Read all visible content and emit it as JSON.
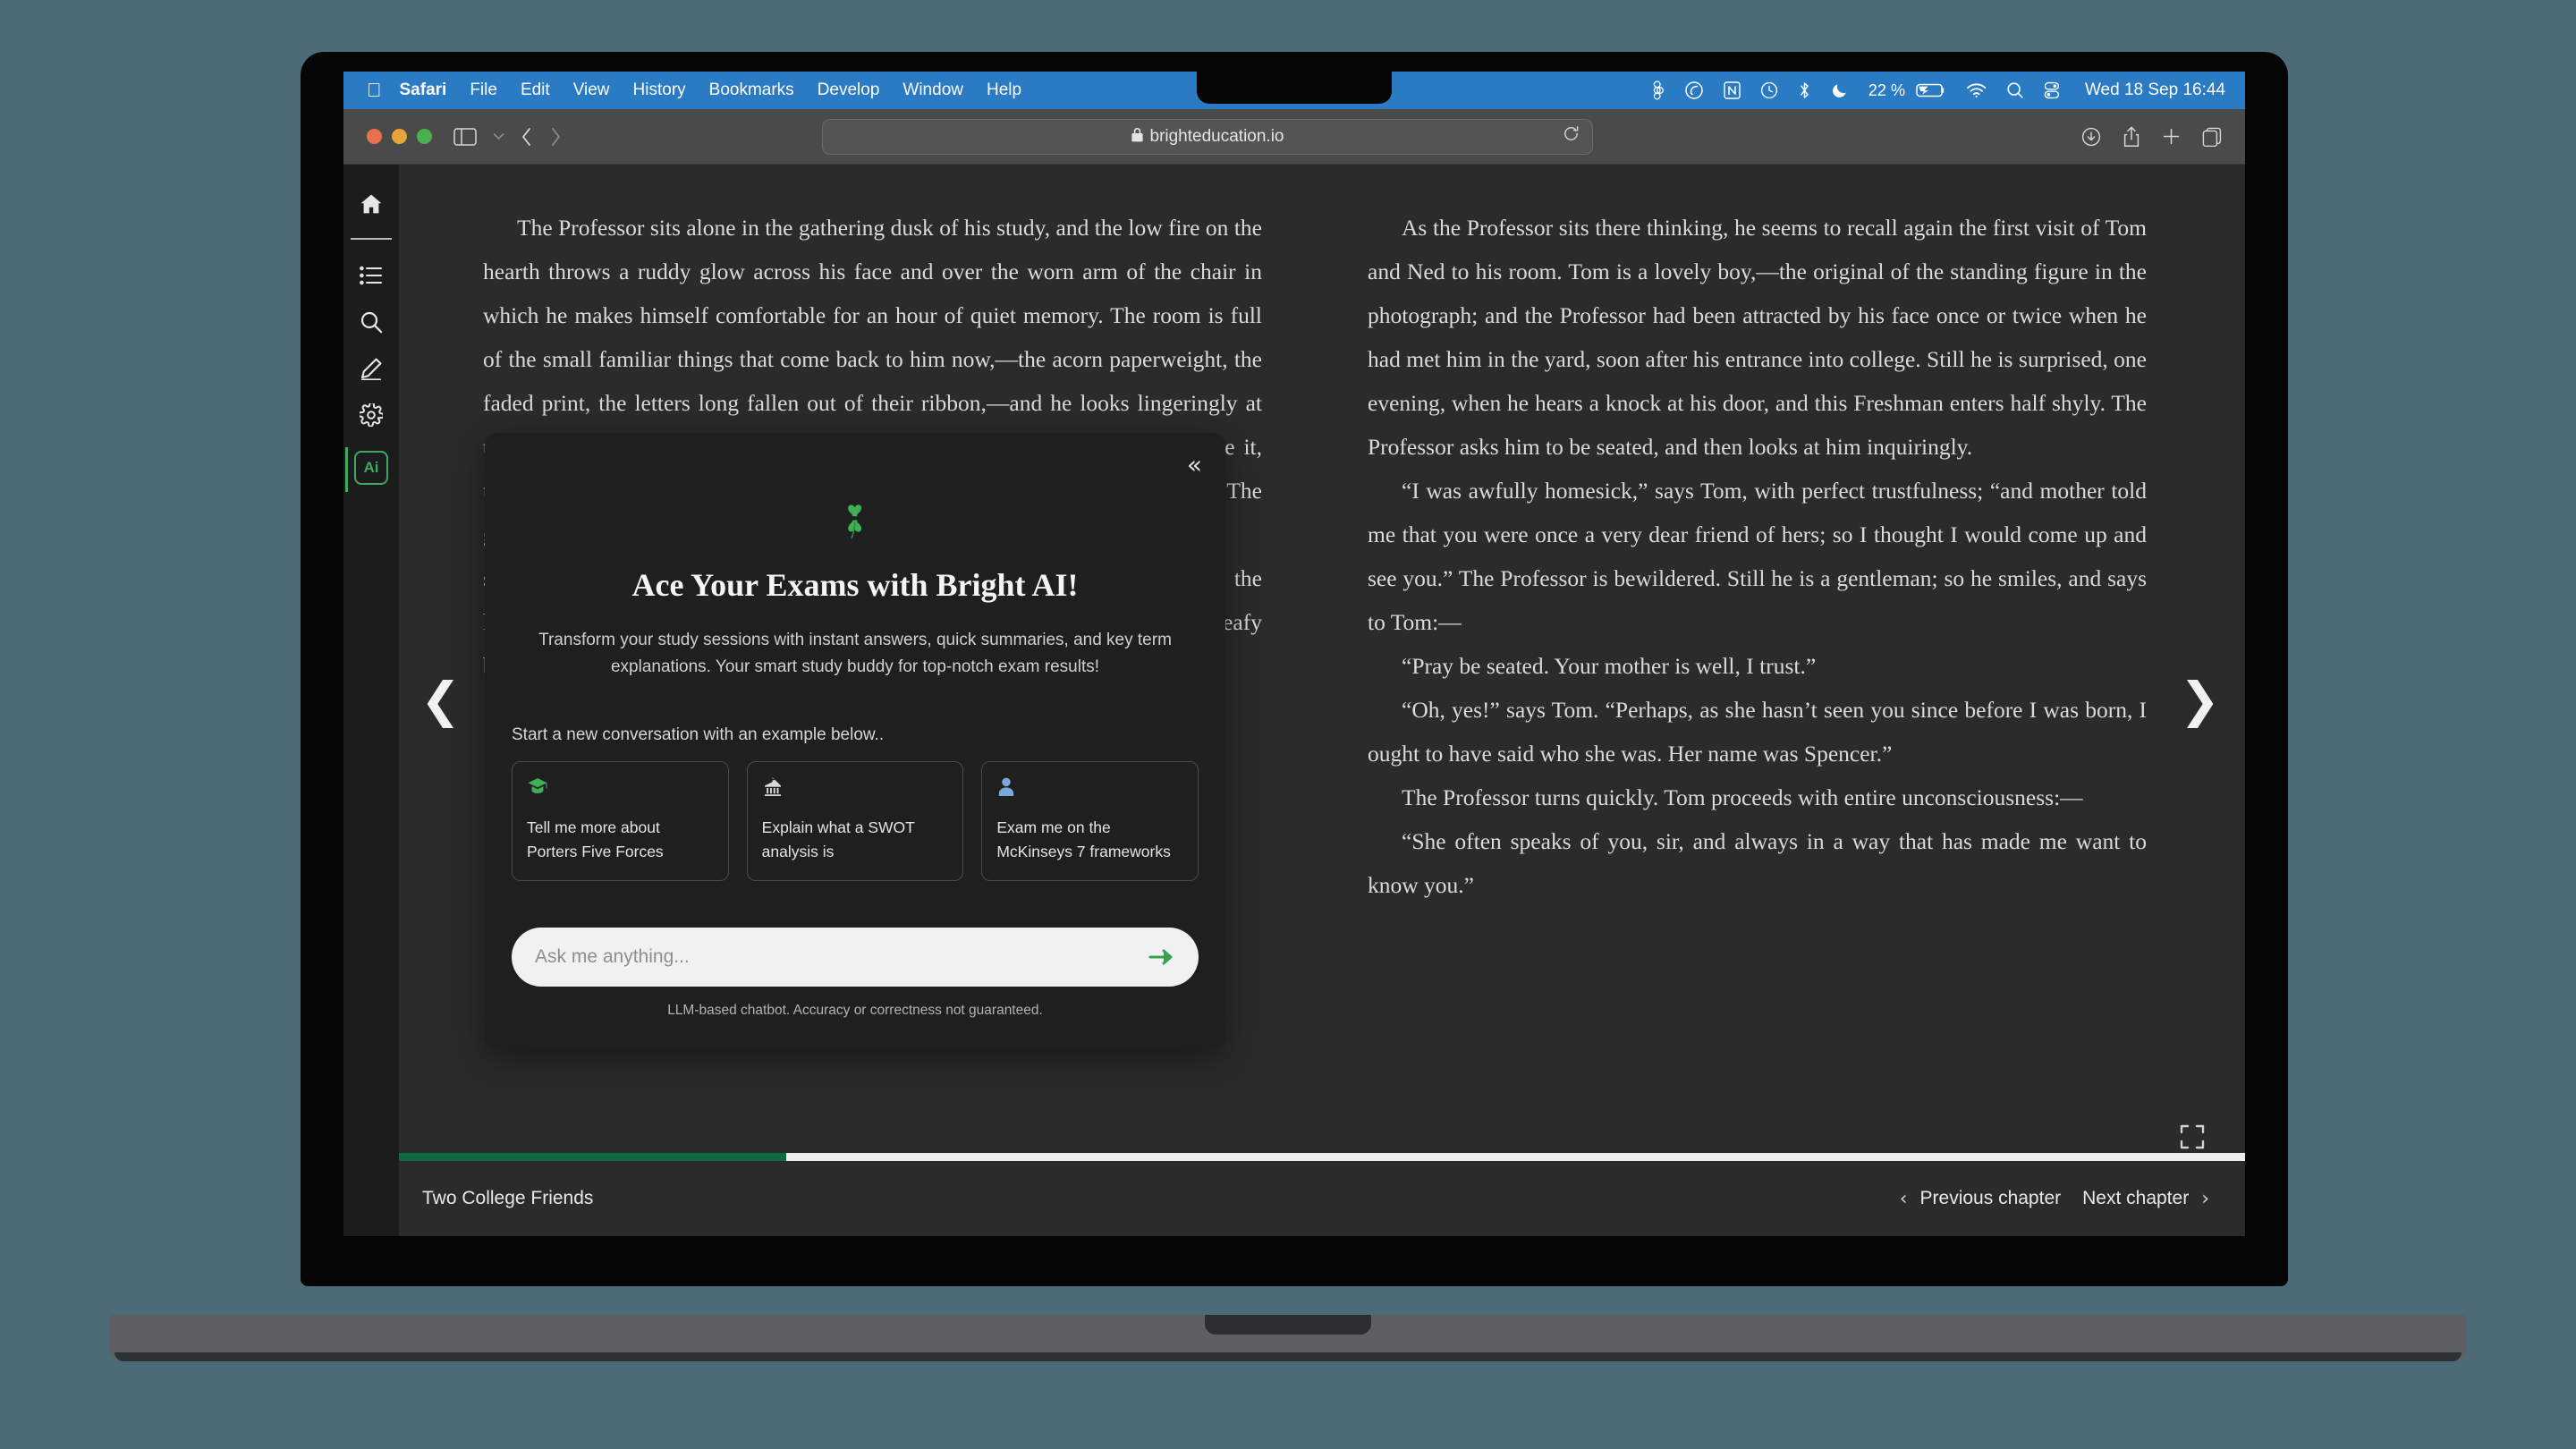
{
  "menubar": {
    "apple_icon": "apple-logo",
    "items": [
      "Safari",
      "File",
      "Edit",
      "View",
      "History",
      "Bookmarks",
      "Develop",
      "Window",
      "Help"
    ],
    "status_icons": [
      "figma-icon",
      "cloud-disc-icon",
      "notion-icon",
      "clock-icon",
      "bluetooth-icon",
      "do-not-disturb-moon-icon",
      "battery-charging-icon",
      "wifi-icon",
      "spotlight-search-icon",
      "control-center-icon"
    ],
    "battery_percent": "22 %",
    "clock": "Wed 18 Sep  16:44"
  },
  "safari": {
    "url": "brighteducation.io",
    "lock_icon": "lock-icon",
    "sidebar_icon": "sidebar-toggle-icon",
    "chevron_down_icon": "chevron-down-icon",
    "back_icon": "back-chevron-icon",
    "forward_icon": "forward-chevron-icon",
    "reload_icon": "reload-icon",
    "downloads_icon": "downloads-icon",
    "share_icon": "share-icon",
    "new_tab_icon": "plus-icon",
    "tab_overview_icon": "tab-overview-icon"
  },
  "sidebar": {
    "items": [
      {
        "icon": "home-icon",
        "name": "home"
      },
      {
        "icon": "list-icon",
        "name": "table-of-contents"
      },
      {
        "icon": "search-icon",
        "name": "search"
      },
      {
        "icon": "highlighter-pen-icon",
        "name": "annotate"
      },
      {
        "icon": "gear-icon",
        "name": "settings"
      }
    ],
    "ai_button_label": "Ai",
    "accent_color": "#3ea95f"
  },
  "ai_modal": {
    "collapse_icon": "double-chevron-left-icon",
    "logo_icon": "four-leaf-clover-icon",
    "title": "Ace Your Exams with Bright AI!",
    "subtitle": "Transform your study sessions with instant answers, quick summaries, and key term explanations. Your smart study buddy for top-notch exam results!",
    "starter_text": "Start a new conversation with an example below..",
    "cards": [
      {
        "icon": "graduation-cap-icon",
        "label": "Tell me more about Porters Five Forces"
      },
      {
        "icon": "bank-building-icon",
        "label": "Explain what a SWOT analysis is"
      },
      {
        "icon": "person-icon",
        "label": "Exam me on the McKinseys 7 frameworks"
      }
    ],
    "input_placeholder": "Ask me anything...",
    "input_value": "",
    "send_icon": "send-arrow-icon",
    "disclaimer": "LLM-based chatbot. Accuracy or correctness not guaranteed."
  },
  "reader": {
    "prev_page_icon": "chevron-left-icon",
    "next_page_icon": "chevron-right-icon",
    "fullscreen_icon": "fullscreen-icon",
    "left_column_paragraphs": [
      "The Professor sits alone in the gathering dusk of his study, and the low fire on the hearth throws a ruddy glow across his face and over the worn arm of the chair in which he makes himself comfortable for an hour of quiet memory. The room is full of the small familiar things that come back to him now,—the acorn paperweight, the faded print, the letters long fallen out of their ribbon,—and he looks lingeringly at the photograph upon the mantel, and then at the face of the young man beside it, until the Professor can scarcely tell which is memory and which is the picture. The grotesque",
      "shadows waver fitfully on the pictures and books around him, as well as on the heavy curtains that hide the rays of afternoon light which struggle through the leafy boughs of the old elms in the yard without."
    ],
    "right_column_paragraphs": [
      "As the Professor sits there thinking, he seems to recall again the first visit of Tom and Ned to his room. Tom is a lovely boy,—the original of the standing figure in the photograph; and the Professor had been attracted by his face once or twice when he had met him in the yard, soon after his entrance into college. Still he is surprised, one evening, when he hears a knock at his door, and this Freshman enters half shyly. The Professor asks him to be seated, and then looks at him inquiringly.",
      "“I was awfully homesick,” says Tom, with perfect trustfulness; “and mother told me that you were once a very dear friend of hers; so I thought I would come up and see you.” The Professor is bewildered. Still he is a gentleman; so he smiles, and says to Tom:—",
      "“Pray be seated. Your mother is well, I trust.”",
      "“Oh, yes!” says Tom. “Perhaps, as she hasn’t seen you since before I was born, I ought to have said who she was. Her name was Spencer.”",
      "The Professor turns quickly. Tom proceeds with entire unconsciousness:—",
      "“She often speaks of you, sir, and always in a way that has made me want to know you.”"
    ]
  },
  "bottombar": {
    "book_title": "Two College Friends",
    "previous_chapter": "Previous chapter",
    "next_chapter": "Next chapter",
    "prev_icon": "chevron-left-icon",
    "next_icon": "chevron-right-icon",
    "progress_percent": 21,
    "progress_color": "#0d6b3f"
  }
}
